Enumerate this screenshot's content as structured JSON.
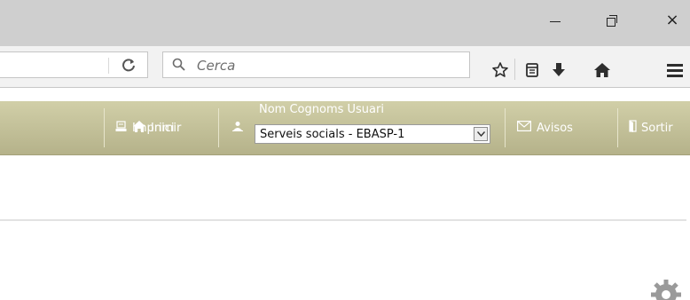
{
  "window": {
    "minimize_label": "",
    "restore_label": "",
    "close_glyph": "×"
  },
  "toolbar": {
    "search_placeholder": "Cerca",
    "icons": [
      "reload-icon",
      "search-icon",
      "star-icon",
      "reading-list-icon",
      "download-icon",
      "home-icon",
      "menu-icon"
    ]
  },
  "appbar": {
    "home_label": "Inici",
    "print_label": "Imprimir",
    "user_name": "Nom Cognoms Usuari",
    "department_selected": "Serveis socials - EBASP-1",
    "notices_label": "Avisos",
    "exit_label": "Sortir"
  },
  "colors": {
    "appbar_top": "#d1cfa8",
    "appbar_bottom": "#b5b28a",
    "titlebar": "#cfcfcf",
    "toolbar": "#f2f2f2"
  }
}
